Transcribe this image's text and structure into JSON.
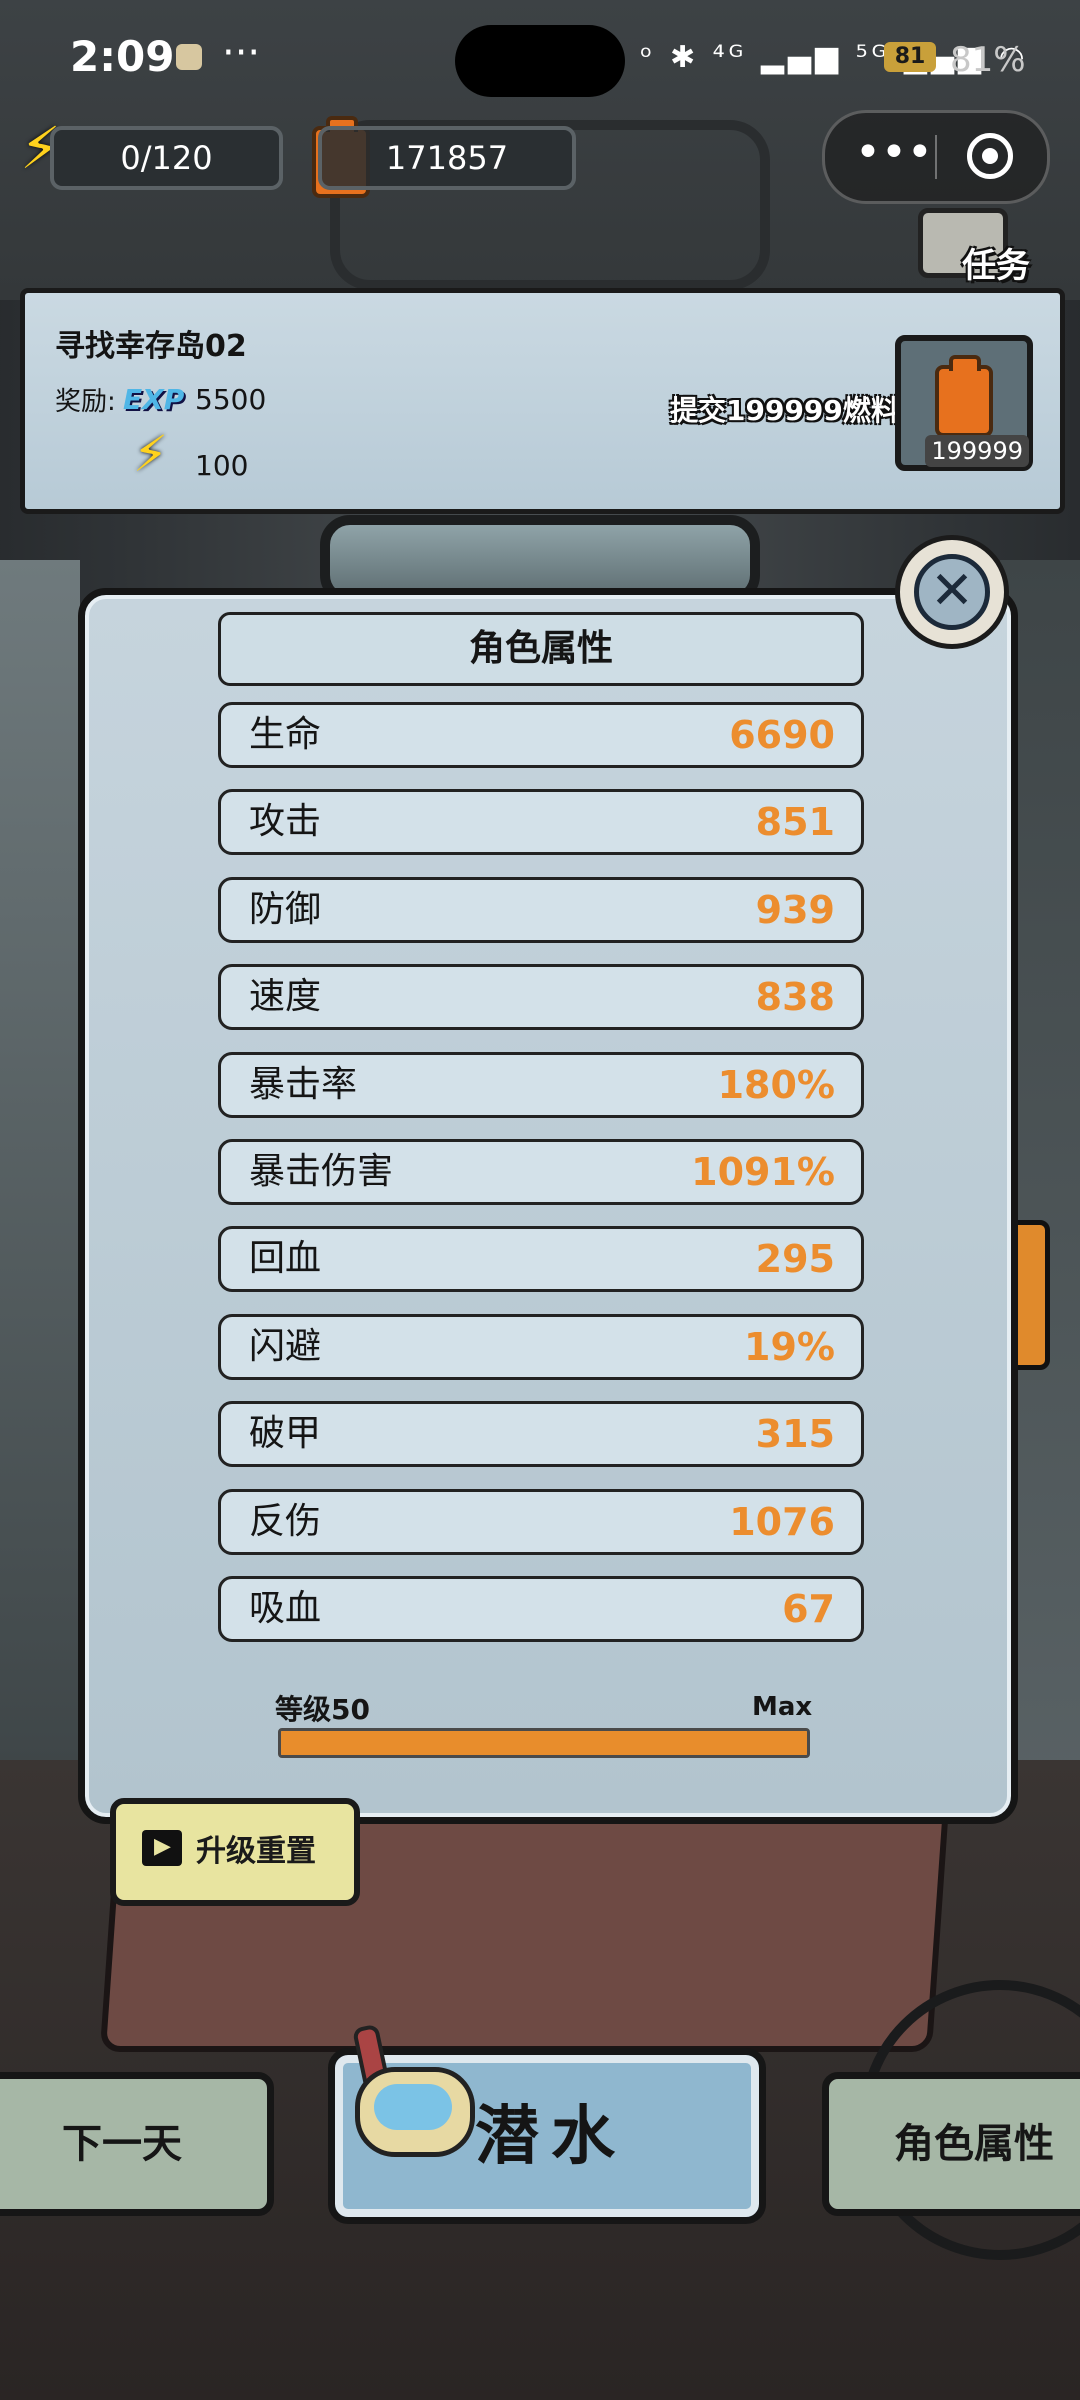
{
  "status_bar": {
    "time": "2:09",
    "overflow": "···",
    "signal_icons": "ᵒ ✱ ⁴ᴳ ▂▄▆ ⁵ᴳ ▂▄▆ ◠",
    "battery_level": "81",
    "battery_percent": "81%"
  },
  "resources": {
    "energy": "0/120",
    "fuel": "171857"
  },
  "capsule": {
    "more": "•••"
  },
  "task_button": {
    "label": "任务"
  },
  "quest": {
    "title": "寻找幸存岛02",
    "reward_label": "奖励:",
    "exp_badge": "EXP",
    "exp_value": "5500",
    "energy_value": "100",
    "submit_text": "提交199999燃料",
    "required_count": "199999"
  },
  "attributes": {
    "title": "角色属性",
    "close_symbol": "✕",
    "rows": [
      {
        "name": "生命",
        "value": "6690"
      },
      {
        "name": "攻击",
        "value": "851"
      },
      {
        "name": "防御",
        "value": "939"
      },
      {
        "name": "速度",
        "value": "838"
      },
      {
        "name": "暴击率",
        "value": "180%"
      },
      {
        "name": "暴击伤害",
        "value": "1091%"
      },
      {
        "name": "回血",
        "value": "295"
      },
      {
        "name": "闪避",
        "value": "19%"
      },
      {
        "name": "破甲",
        "value": "315"
      },
      {
        "name": "反伤",
        "value": "1076"
      },
      {
        "name": "吸血",
        "value": "67"
      }
    ],
    "level_label": "等级50",
    "level_max": "Max",
    "level_progress": 1.0
  },
  "reset_button": {
    "label": "升级重置"
  },
  "bottom_nav": {
    "next_day": "下一天",
    "dive": "潜水",
    "attributes": "角色属性"
  },
  "colors": {
    "value_orange": "#ec8d2e",
    "panel_blue": "#c6d4dd",
    "energy_yellow": "#ffd21d",
    "fuel_orange": "#e7711e"
  }
}
